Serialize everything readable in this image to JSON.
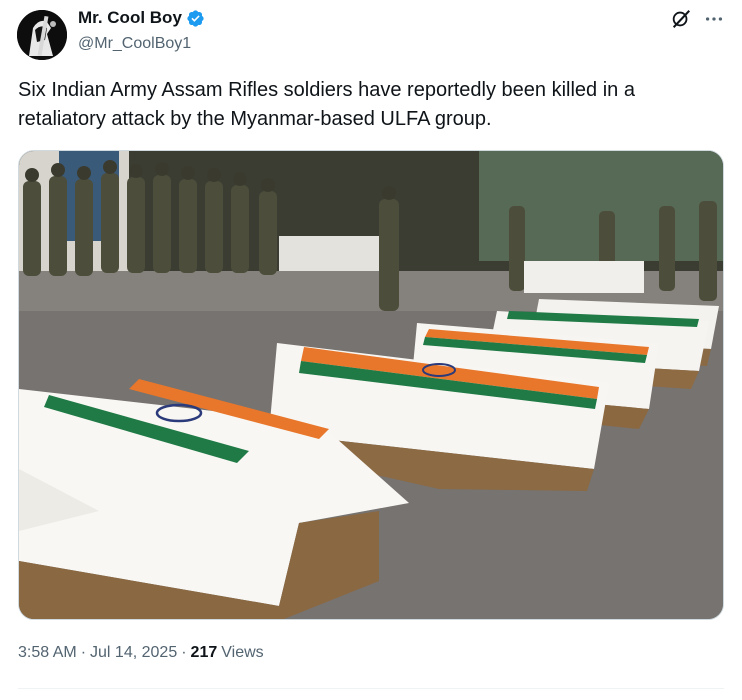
{
  "author": {
    "name": "Mr. Cool Boy",
    "handle": "@Mr_CoolBoy1",
    "verified": true,
    "verified_color": "#1d9bf0"
  },
  "tweet": {
    "text": "Six Indian Army Assam Rifles soldiers have reportedly been killed in a retaliatory attack by the Myanmar-based ULFA group."
  },
  "meta": {
    "time": "3:58 AM",
    "sep1": "·",
    "date": "Jul 14, 2025",
    "sep2": "·",
    "views_count": "217",
    "views_label": "Views"
  },
  "icons": {
    "grok": "grok-icon",
    "more": "more-icon",
    "verified": "verified-badge-icon"
  }
}
